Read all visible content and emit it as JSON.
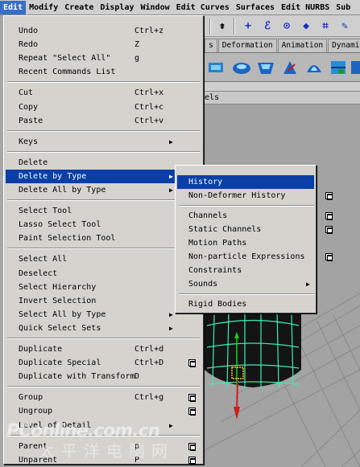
{
  "menubar": {
    "items": [
      "Edit",
      "Modify",
      "Create",
      "Display",
      "Window",
      "Edit Curves",
      "Surfaces",
      "Edit NURBS",
      "Sub"
    ],
    "active_index": 0
  },
  "shelf_tabs": [
    "s",
    "Deformation",
    "Animation",
    "Dynamic"
  ],
  "panel_label": "els",
  "edit_menu": {
    "groups": [
      [
        {
          "label": "Undo",
          "shortcut": "Ctrl+z"
        },
        {
          "label": "Redo",
          "shortcut": "Z"
        },
        {
          "label": "Repeat \"Select All\"",
          "shortcut": "g"
        },
        {
          "label": "Recent Commands List",
          "shortcut": ""
        }
      ],
      [
        {
          "label": "Cut",
          "shortcut": "Ctrl+x"
        },
        {
          "label": "Copy",
          "shortcut": "Ctrl+c"
        },
        {
          "label": "Paste",
          "shortcut": "Ctrl+v"
        }
      ],
      [
        {
          "label": "Keys",
          "submenu": true
        }
      ],
      [
        {
          "label": "Delete"
        },
        {
          "label": "Delete by Type",
          "submenu": true,
          "selected": true
        },
        {
          "label": "Delete All by Type",
          "submenu": true
        }
      ],
      [
        {
          "label": "Select Tool"
        },
        {
          "label": "Lasso Select Tool"
        },
        {
          "label": "Paint Selection Tool"
        }
      ],
      [
        {
          "label": "Select All"
        },
        {
          "label": "Deselect"
        },
        {
          "label": "Select Hierarchy"
        },
        {
          "label": "Invert Selection"
        },
        {
          "label": "Select All by Type",
          "submenu": true
        },
        {
          "label": "Quick Select Sets",
          "submenu": true
        }
      ],
      [
        {
          "label": "Duplicate",
          "shortcut": "Ctrl+d"
        },
        {
          "label": "Duplicate Special",
          "shortcut": "Ctrl+D",
          "option": true
        },
        {
          "label": "Duplicate with Transform",
          "shortcut": "D"
        }
      ],
      [
        {
          "label": "Group",
          "shortcut": "Ctrl+g",
          "option": true
        },
        {
          "label": "Ungroup",
          "option": true
        },
        {
          "label": "Level of Detail",
          "submenu": true
        }
      ],
      [
        {
          "label": "Parent",
          "shortcut": "p",
          "option": true
        },
        {
          "label": "Unparent",
          "shortcut": "P",
          "option": true
        }
      ]
    ]
  },
  "delete_by_type_submenu": {
    "groups": [
      [
        {
          "label": "History",
          "selected": true
        },
        {
          "label": "Non-Deformer History",
          "option": true
        }
      ],
      [
        {
          "label": "Channels",
          "option": true
        },
        {
          "label": "Static Channels",
          "option": true
        },
        {
          "label": "Motion Paths"
        },
        {
          "label": "Non-particle Expressions",
          "option": true
        },
        {
          "label": "Constraints"
        },
        {
          "label": "Sounds",
          "submenu": true
        }
      ],
      [
        {
          "label": "Rigid Bodies"
        }
      ]
    ]
  },
  "watermark": {
    "text": "PConline.com.cn",
    "subtext": "太平洋电脑网"
  },
  "colors": {
    "menu_bg": "#d6d3ce",
    "selection": "#0a3fa8",
    "menubar_active": "#3a6ec4",
    "wireframe": "#3cf0b8",
    "viewport_bg": "#a3a3a3",
    "object": "#141414"
  }
}
